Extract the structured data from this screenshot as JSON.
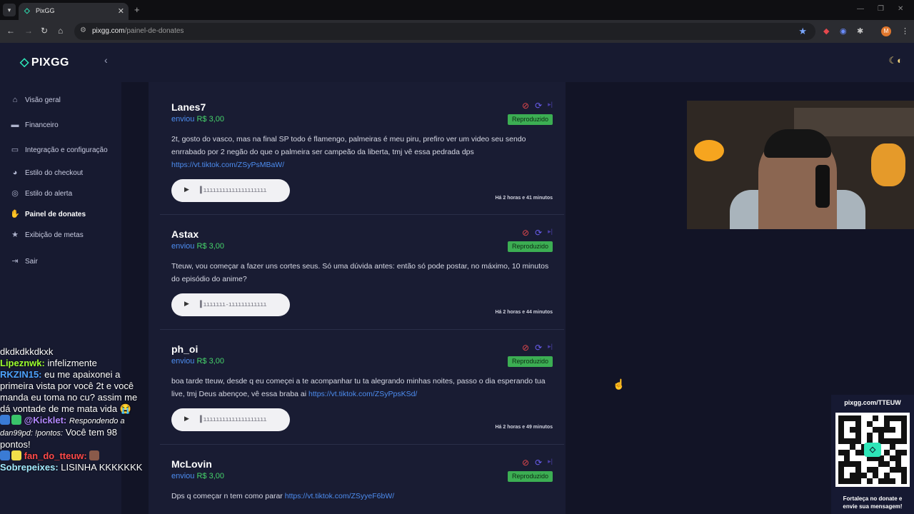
{
  "browser": {
    "tab_title": "PixGG",
    "url_host": "pixgg.com",
    "url_path": "/painel-de-donates",
    "profile_initial": "M"
  },
  "sidebar": {
    "logo": "PIXGG",
    "items": [
      {
        "label": "Visão geral",
        "icon": "home-icon"
      },
      {
        "label": "Financeiro",
        "icon": "wallet-icon"
      },
      {
        "label": "Integração e configuração",
        "icon": "integration-icon"
      },
      {
        "label": "Estilo do checkout",
        "icon": "palette-icon"
      },
      {
        "label": "Estilo do alerta",
        "icon": "alert-style-icon"
      },
      {
        "label": "Painel de donates",
        "icon": "donate-icon"
      },
      {
        "label": "Exibição de metas",
        "icon": "star-icon"
      },
      {
        "label": "Sair",
        "icon": "logout-icon"
      }
    ]
  },
  "donations": [
    {
      "name": "Lanes7",
      "verb": "enviou",
      "amount": "R$ 3,00",
      "status": "Reproduzido",
      "message": "2t, gosto do vasco, mas na final SP todo é flamengo, palmeiras é meu piru, prefiro ver um video seu sendo enrrabado por 2 negão do que o palmeira ser campeão da liberta, tmj vê essa pedrada dps",
      "link": "https://vt.tiktok.com/ZSyPsMBaW/",
      "time": "Há 2 horas e 41 minutos"
    },
    {
      "name": "Astax",
      "verb": "enviou",
      "amount": "R$ 3,00",
      "status": "Reproduzido",
      "message": "Tteuw, vou começar a fazer uns cortes seus. Só uma dúvida antes: então só pode postar, no máximo, 10 minutos do episódio do anime?",
      "link": "",
      "time": "Há 2 horas e 44 minutos"
    },
    {
      "name": "ph_oi",
      "verb": "enviou",
      "amount": "R$ 3,00",
      "status": "Reproduzido",
      "message": "boa tarde tteuw, desde q eu começei a te acompanhar tu ta alegrando minhas noites, passo o dia esperando tua live, tmj Deus abençoe, vê essa braba ai",
      "link": "https://vt.tiktok.com/ZSyPpsKSd/",
      "time": "Há 2 horas e 49 minutos"
    },
    {
      "name": "McLovin",
      "verb": "enviou",
      "amount": "R$ 3,00",
      "status": "Reproduzido",
      "message": "Dps q começar n tem como parar",
      "link": "https://vt.tiktok.com/ZSyyeF6bW/",
      "time": ""
    }
  ],
  "chat": [
    {
      "user": "",
      "text": "dkdkdkkdkxk"
    },
    {
      "user": "Lipeznwk:",
      "text": "infelizmente"
    },
    {
      "user": "RKZIN15:",
      "text": "eu me apaixonei a primeira vista por você 2t e você manda eu toma no cu? assim me dá vontade de me mata vida 😭"
    },
    {
      "user": "@Kicklet:",
      "reply": "Respondendo a dan99pd: !pontos:",
      "text": "Você tem 98 pontos!"
    },
    {
      "user": "fan_do_tteuw:",
      "text": ""
    },
    {
      "user": "Sobrepeixes:",
      "text": "LISINHA KKKKKKK"
    }
  ],
  "qr": {
    "title": "pixgg.com/TTEUW",
    "caption_line1": "Fortaleça no donate e",
    "caption_line2": "envie sua mensagem!"
  },
  "colors": {
    "accent": "#2ee6b8",
    "amount": "#46d36b",
    "link": "#4d8df0",
    "badge": "#3cae53",
    "block": "#e5484d"
  }
}
